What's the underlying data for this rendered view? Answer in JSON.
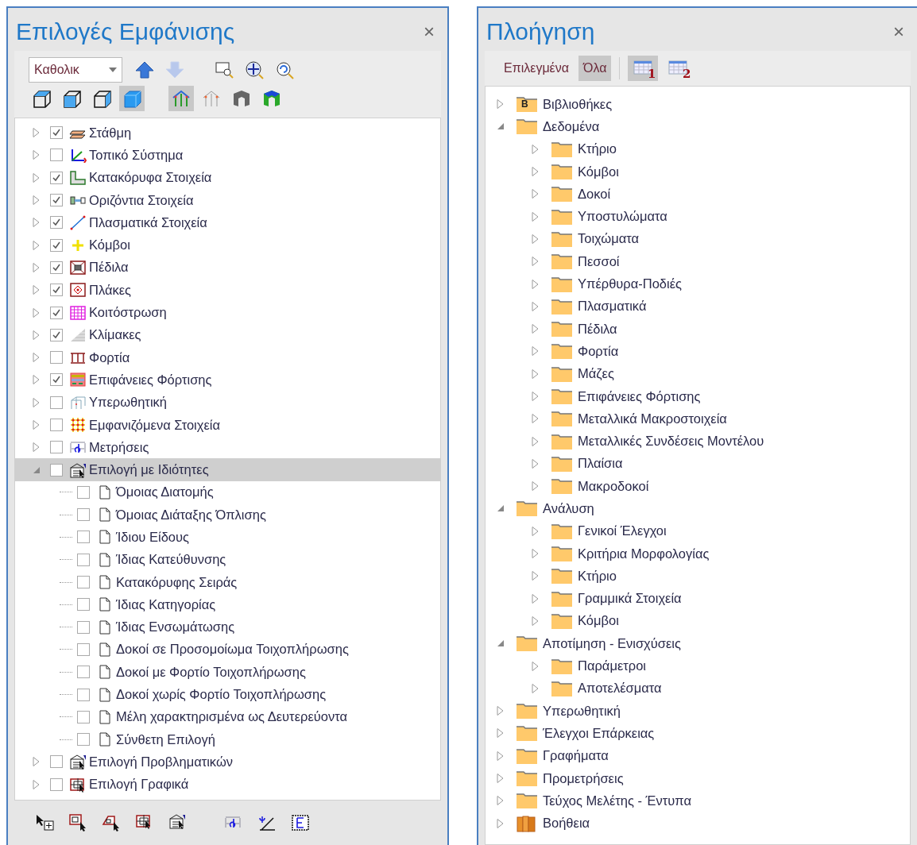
{
  "display_panel": {
    "title": "Επιλογές Εμφάνισης",
    "close": "×",
    "dropdown": {
      "value": "Καθολικ"
    },
    "nav_buttons": [
      {
        "disabled": false
      },
      {
        "disabled": true
      }
    ],
    "view_buttons": [
      {
        "pressed": false
      },
      {
        "pressed": false
      },
      {
        "pressed": false
      },
      {
        "pressed": true
      },
      {
        "pressed": true
      },
      {
        "pressed": false
      },
      {
        "pressed": false
      },
      {
        "pressed": false
      }
    ],
    "tree": [
      {
        "label": "Στάθμη",
        "checked": true,
        "expanded": false,
        "selected": false
      },
      {
        "label": "Τοπικό Σύστημα",
        "checked": false,
        "expanded": false,
        "selected": false
      },
      {
        "label": "Κατακόρυφα Στοιχεία",
        "checked": true,
        "expanded": false,
        "selected": false
      },
      {
        "label": "Οριζόντια Στοιχεία",
        "checked": true,
        "expanded": false,
        "selected": false
      },
      {
        "label": "Πλασματικά Στοιχεία",
        "checked": true,
        "expanded": false,
        "selected": false
      },
      {
        "label": "Κόμβοι",
        "checked": true,
        "expanded": false,
        "selected": false
      },
      {
        "label": "Πέδιλα",
        "checked": true,
        "expanded": false,
        "selected": false
      },
      {
        "label": "Πλάκες",
        "checked": true,
        "expanded": false,
        "selected": false
      },
      {
        "label": "Κοιτόστρωση",
        "checked": true,
        "expanded": false,
        "selected": false
      },
      {
        "label": "Κλίμακες",
        "checked": true,
        "expanded": false,
        "selected": false
      },
      {
        "label": "Φορτία",
        "checked": false,
        "expanded": false,
        "selected": false
      },
      {
        "label": "Επιφάνειες Φόρτισης",
        "checked": true,
        "expanded": false,
        "selected": false
      },
      {
        "label": "Υπερωθητική",
        "checked": false,
        "expanded": false,
        "selected": false
      },
      {
        "label": "Εμφανιζόμενα Στοιχεία",
        "checked": false,
        "expanded": false,
        "selected": false
      },
      {
        "label": "Μετρήσεις",
        "checked": false,
        "expanded": false,
        "selected": false
      },
      {
        "label": "Επιλογή με Ιδιότητες",
        "checked": false,
        "expanded": true,
        "selected": true,
        "children": [
          {
            "label": "Όμοιας Διατομής",
            "checked": false
          },
          {
            "label": "Όμοιας Διάταξης Όπλισης",
            "checked": false
          },
          {
            "label": "Ίδιου Είδους",
            "checked": false
          },
          {
            "label": "Ίδιας Κατεύθυνσης",
            "checked": false
          },
          {
            "label": "Κατακόρυφης Σειράς",
            "checked": false
          },
          {
            "label": "Ίδιας Κατηγορίας",
            "checked": false
          },
          {
            "label": "Ίδιας Ενσωμάτωσης",
            "checked": false
          },
          {
            "label": "Δοκοί σε Προσομοίωμα Τοιχοπλήρωσης",
            "checked": false
          },
          {
            "label": "Δοκοί με Φορτίο Τοιχοπλήρωσης",
            "checked": false
          },
          {
            "label": "Δοκοί χωρίς Φορτίο Τοιχοπλήρωσης",
            "checked": false
          },
          {
            "label": "Μέλη χαρακτηρισμένα ως Δευτερεύοντα",
            "checked": false
          },
          {
            "label": "Σύνθετη Επιλογή",
            "checked": false
          }
        ]
      },
      {
        "label": "Επιλογή Προβληματικών",
        "checked": false,
        "expanded": false,
        "selected": false
      },
      {
        "label": "Επιλογή Γραφικά",
        "checked": false,
        "expanded": false,
        "selected": false
      }
    ]
  },
  "navigation_panel": {
    "title": "Πλοήγηση",
    "close": "×",
    "filters": [
      {
        "label": "Επιλεγμένα",
        "selected": false
      },
      {
        "label": "Όλα",
        "selected": true
      }
    ],
    "layout_buttons": [
      {
        "label": "1",
        "pressed": true
      },
      {
        "label": "2",
        "pressed": false
      }
    ],
    "tree": [
      {
        "label": "Βιβλιοθήκες",
        "kind": "folder",
        "badge": "B",
        "expanded": false
      },
      {
        "label": "Δεδομένα",
        "kind": "folder",
        "expanded": true,
        "children": [
          {
            "label": "Κτήριο",
            "expanded": false
          },
          {
            "label": "Κόμβοι",
            "expanded": false
          },
          {
            "label": "Δοκοί",
            "expanded": false
          },
          {
            "label": "Υποστυλώματα",
            "expanded": false
          },
          {
            "label": "Τοιχώματα",
            "expanded": false
          },
          {
            "label": "Πεσσοί",
            "expanded": false
          },
          {
            "label": "Υπέρθυρα-Ποδιές",
            "expanded": false
          },
          {
            "label": "Πλασματικά",
            "expanded": false
          },
          {
            "label": "Πέδιλα",
            "expanded": false
          },
          {
            "label": "Φορτία",
            "expanded": false
          },
          {
            "label": "Μάζες",
            "expanded": false
          },
          {
            "label": "Επιφάνειες Φόρτισης",
            "expanded": false
          },
          {
            "label": "Μεταλλικά Μακροστοιχεία",
            "expanded": false
          },
          {
            "label": "Μεταλλικές Συνδέσεις Μοντέλου",
            "expanded": false
          },
          {
            "label": "Πλαίσια",
            "expanded": false
          },
          {
            "label": "Μακροδοκοί",
            "expanded": false
          }
        ]
      },
      {
        "label": "Ανάλυση",
        "kind": "folder",
        "expanded": true,
        "children": [
          {
            "label": "Γενικοί Έλεγχοι",
            "expanded": false
          },
          {
            "label": "Κριτήρια Μορφολογίας",
            "expanded": false
          },
          {
            "label": "Κτήριο",
            "expanded": false
          },
          {
            "label": "Γραμμικά Στοιχεία",
            "expanded": false
          },
          {
            "label": "Κόμβοι",
            "expanded": false
          }
        ]
      },
      {
        "label": "Αποτίμηση - Ενισχύσεις",
        "kind": "folder",
        "expanded": true,
        "children": [
          {
            "label": "Παράμετροι",
            "expanded": false
          },
          {
            "label": "Αποτελέσματα",
            "expanded": false
          }
        ]
      },
      {
        "label": "Υπερωθητική",
        "kind": "folder",
        "expanded": false
      },
      {
        "label": "Έλεγχοι Επάρκειας",
        "kind": "folder",
        "expanded": false
      },
      {
        "label": "Γραφήματα",
        "kind": "folder",
        "expanded": false
      },
      {
        "label": "Προμετρήσεις",
        "kind": "folder",
        "expanded": false
      },
      {
        "label": "Τεύχος Μελέτης - Έντυπα",
        "kind": "folder",
        "expanded": false
      },
      {
        "label": "Βοήθεια",
        "kind": "book",
        "expanded": false
      }
    ]
  }
}
